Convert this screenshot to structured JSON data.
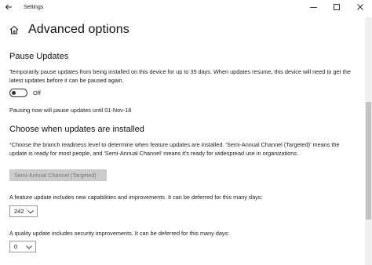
{
  "window": {
    "title": "Settings"
  },
  "header": {
    "title": "Advanced options"
  },
  "pause": {
    "heading": "Pause Updates",
    "description": "Temporarily pause updates from being installed on this device for up to 35 days. When updates resume, this device will need to get the latest updates before it can be paused again.",
    "toggle_state": "Off",
    "status": "Pausing now will pause updates until 01-Nov-18"
  },
  "choose": {
    "heading": "Choose when updates are installed",
    "required_mark": "*",
    "description": "Choose the branch readiness level to determine when feature updates are installed. 'Semi-Annual Channel (Targeted)' means the update is ready for most people, and 'Semi-Annual Channel' means it's ready for widespread use in organizations.",
    "branch_value": "Semi-Annual Channel (Targeted)",
    "feature_label": "A feature update includes new capabilities and improvements. It can be deferred for this many days:",
    "feature_value": "242",
    "quality_label": "A quality update includes security improvements. It can be deferred for this many days:",
    "quality_value": "0"
  },
  "icons": {
    "back": "back-arrow-icon",
    "home": "home-icon",
    "minimize": "minimize-icon",
    "maximize": "maximize-icon",
    "close": "close-icon",
    "chevron": "chevron-down-icon"
  },
  "colors": {
    "required": "#c50f1f",
    "disabled_fill": "#cccccc"
  }
}
